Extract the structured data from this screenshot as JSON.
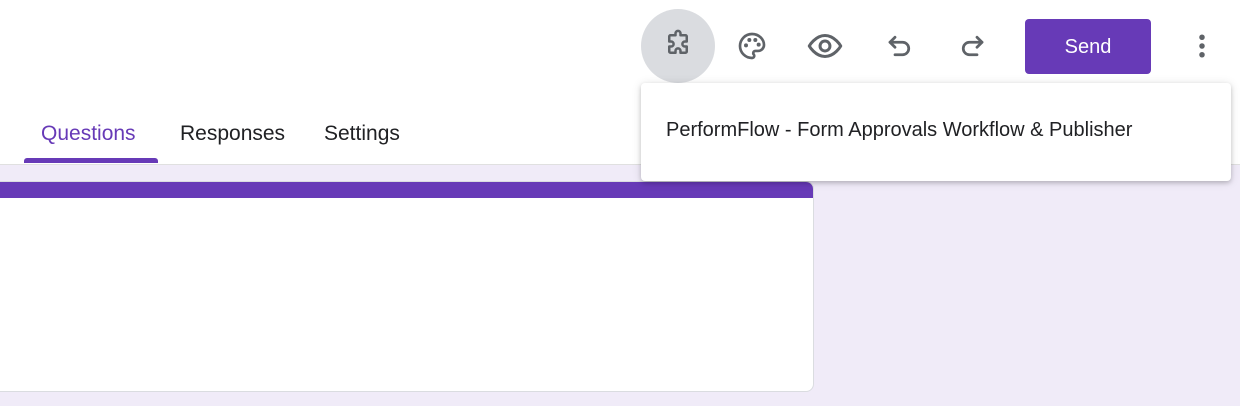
{
  "toolbar": {
    "icons": [
      "puzzle-icon",
      "palette-icon",
      "eye-icon",
      "undo-icon",
      "redo-icon",
      "more-vert-icon"
    ],
    "send_label": "Send",
    "accent_color": "#673ab7"
  },
  "tabs": [
    {
      "label": "Questions",
      "active": true
    },
    {
      "label": "Responses",
      "active": false
    },
    {
      "label": "Settings",
      "active": false
    }
  ],
  "addons_menu": {
    "items": [
      {
        "label": "PerformFlow - Form Approvals Workflow & Publisher"
      }
    ]
  },
  "colors": {
    "background": "#f0ebf8",
    "primary": "#673ab7",
    "text": "#202124"
  }
}
